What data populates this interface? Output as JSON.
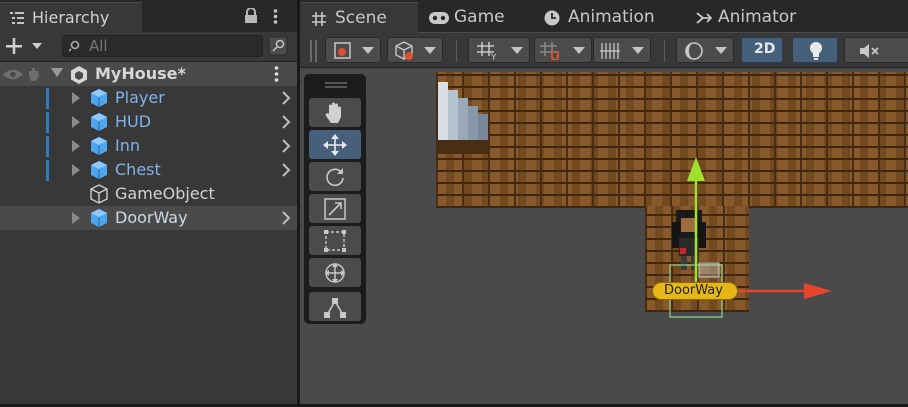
{
  "hierarchy": {
    "title": "Hierarchy",
    "search_placeholder": "All",
    "scene_name": "MyHouse*",
    "items": [
      {
        "label": "Player",
        "prefab": true,
        "expandable": true
      },
      {
        "label": "HUD",
        "prefab": true,
        "expandable": true
      },
      {
        "label": "Inn",
        "prefab": true,
        "expandable": true
      },
      {
        "label": "Chest",
        "prefab": true,
        "expandable": true
      },
      {
        "label": "GameObject",
        "prefab": false,
        "expandable": false
      },
      {
        "label": "DoorWay",
        "prefab": true,
        "expandable": true,
        "selected": true
      }
    ]
  },
  "tabs": [
    {
      "label": "Scene",
      "icon": "grid-icon",
      "active": true
    },
    {
      "label": "Game",
      "icon": "gamepad-icon",
      "active": false
    },
    {
      "label": "Animation",
      "icon": "clock-icon",
      "active": false
    },
    {
      "label": "Animator",
      "icon": "animator-icon",
      "active": false
    }
  ],
  "scene_toolbar": {
    "mode_2d_label": "2D"
  },
  "scene": {
    "selected_object_label": "DoorWay"
  },
  "colors": {
    "prefab_text": "#7fb4ee",
    "plain_text": "#d2d2d2",
    "selection_bar": "#2c7bc5",
    "active_button": "#46607c",
    "gizmo_x": "#e8442a",
    "gizmo_y": "#9fe22e",
    "label_bg": "#e6b817"
  }
}
